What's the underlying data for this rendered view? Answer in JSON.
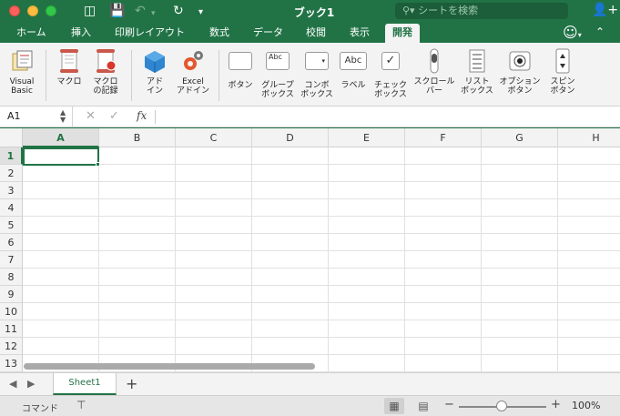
{
  "window": {
    "title": "ブック1",
    "search_placeholder": "シートを検索"
  },
  "tabs": [
    {
      "label": "ホーム"
    },
    {
      "label": "挿入"
    },
    {
      "label": "印刷レイアウト"
    },
    {
      "label": "数式"
    },
    {
      "label": "データ"
    },
    {
      "label": "校閲"
    },
    {
      "label": "表示"
    },
    {
      "label": "開発"
    }
  ],
  "ribbon": {
    "visual_basic": "Visual\nBasic",
    "macro": "マクロ",
    "macro_record": "マクロ\nの記録",
    "addin": "アド\nイン",
    "excel_addin": "Excel\nアドイン",
    "button": "ボタン",
    "groupbox": "グループ\nボックス",
    "combobox": "コンボ\nボックス",
    "label": "ラベル",
    "checkbox": "チェック\nボックス",
    "scrollbar": "スクロール\nバー",
    "listbox": "リスト\nボックス",
    "option": "オプション\nボタン",
    "spin": "スピン\nボタン",
    "groupbox_icon_text": "Abc",
    "label_icon_text": "Abc"
  },
  "formula_bar": {
    "name_box": "A1",
    "fx": "fx",
    "value": ""
  },
  "grid": {
    "columns": [
      "A",
      "B",
      "C",
      "D",
      "E",
      "F",
      "G",
      "H"
    ],
    "rows": [
      "1",
      "2",
      "3",
      "4",
      "5",
      "6",
      "7",
      "8",
      "9",
      "10",
      "11",
      "12",
      "13"
    ],
    "selected_cell": "A1"
  },
  "sheets": {
    "tabs": [
      {
        "label": "Sheet1"
      }
    ],
    "add": "+"
  },
  "status": {
    "mode": "コマンド",
    "zoom": "100%"
  },
  "colors": {
    "accent": "#217346"
  }
}
